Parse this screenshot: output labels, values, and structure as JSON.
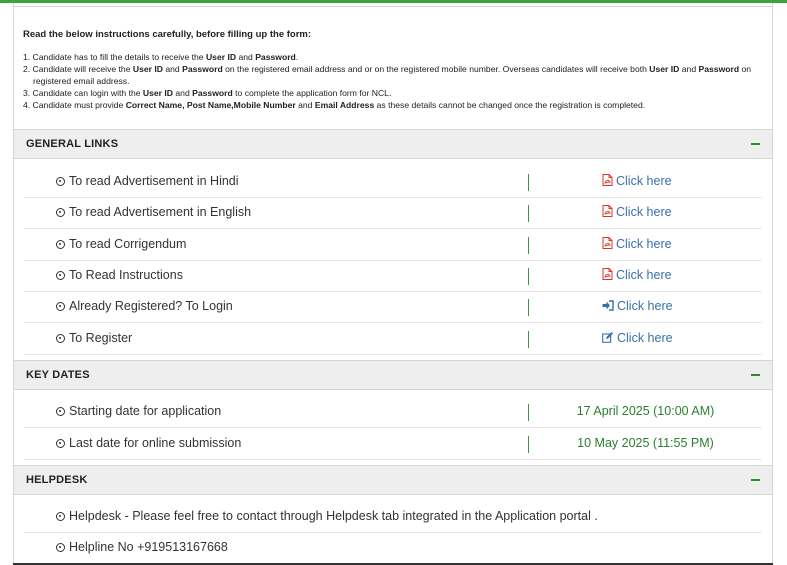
{
  "instructions": {
    "title": "Read the below instructions carefully, before filling up the form:",
    "items": [
      [
        "1. Candidate has to fill the details to receive the ",
        {
          "b": "User ID"
        },
        " and ",
        {
          "b": "Password"
        },
        "."
      ],
      [
        "2. Candidate will receive the ",
        {
          "b": "User ID"
        },
        " and ",
        {
          "b": "Password"
        },
        " on the registered email address and or on the registered mobile number. Overseas candidates will receive both ",
        {
          "b": "User ID"
        },
        " and ",
        {
          "b": "Password"
        },
        " on registered email address."
      ],
      [
        "3. Candidate can login with the ",
        {
          "b": "User ID"
        },
        " and ",
        {
          "b": "Password"
        },
        " to complete the application form for NCL."
      ],
      [
        "4. Candidate must provide ",
        {
          "b": "Correct Name, Post Name,Mobile Number"
        },
        " and ",
        {
          "b": "Email Address"
        },
        " as these details cannot be changed once the registration is completed."
      ]
    ]
  },
  "general_links": {
    "title": "GENERAL LINKS",
    "rows": [
      {
        "label": "To read Advertisement in Hindi",
        "link": "Click here",
        "icon": "pdf-icon"
      },
      {
        "label": "To read Advertisement in English",
        "link": "Click here",
        "icon": "pdf-icon"
      },
      {
        "label": "To read Corrigendum",
        "link": "Click here",
        "icon": "pdf-icon"
      },
      {
        "label": "To Read Instructions",
        "link": "Click here",
        "icon": "pdf-icon"
      },
      {
        "label": "Already Registered? To Login",
        "link": "Click here",
        "icon": "sign-in-icon"
      },
      {
        "label": "To Register",
        "link": "Click here",
        "icon": "edit-icon"
      }
    ]
  },
  "key_dates": {
    "title": "KEY DATES",
    "rows": [
      {
        "label": "Starting date for application",
        "value": "17 April 2025 (10:00 AM)"
      },
      {
        "label": "Last date for online submission",
        "value": "10 May 2025 (11:55 PM)"
      }
    ]
  },
  "helpdesk": {
    "title": "HELPDESK",
    "rows": [
      {
        "label": "Helpdesk - Please feel free to contact through Helpdesk tab integrated in the Application portal ."
      },
      {
        "label": "Helpline No +919513167668"
      }
    ]
  },
  "colors": {
    "accent_green": "#3aa635",
    "link_blue": "#3a6fa8",
    "date_green": "#2e7d32",
    "pdf_red": "#d9342b"
  }
}
